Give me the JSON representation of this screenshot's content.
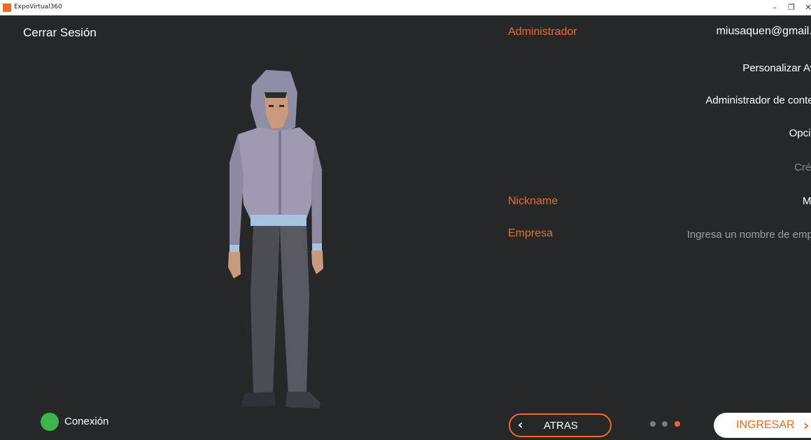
{
  "window": {
    "title": "ExpoVirtual360",
    "min_glyph": "–",
    "restore_glyph": "❐",
    "close_glyph": "✕"
  },
  "sidebar": {
    "logout_label": "Cerrar Sesión",
    "connection_label": "Conexión",
    "connection_color": "#3bb54a"
  },
  "header": {
    "role_label": "Administrador",
    "email": "miusaquen@gmail.com"
  },
  "menu": {
    "items": [
      {
        "label": "Personalizar Avatar"
      },
      {
        "label": "Administrador de contenido"
      },
      {
        "label": "Opciones"
      },
      {
        "label": "Créditos"
      }
    ]
  },
  "profile": {
    "nickname_label": "Nickname",
    "nickname_value": "Miguel",
    "company_label": "Empresa",
    "company_placeholder": "Ingresa un nombre de empresa",
    "company_value": ""
  },
  "footer": {
    "back_label": "ATRAS",
    "back_icon": "chevron-left-icon",
    "next_label": "INGRESAR",
    "next_icon": "chevron-right-icon",
    "page_current": 3,
    "page_total": 3
  },
  "colors": {
    "accent": "#f26a21",
    "background": "#262729",
    "text": "#ffffff",
    "muted": "#8a8a8a"
  }
}
